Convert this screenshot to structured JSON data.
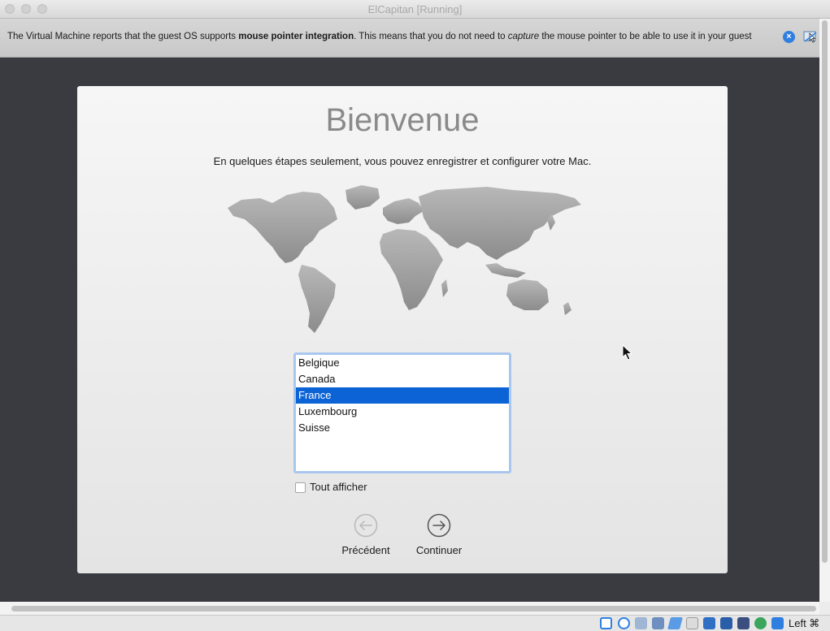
{
  "window": {
    "title": "ElCapitan [Running]"
  },
  "notice": {
    "text_1": "The Virtual Machine reports that the guest OS supports ",
    "text_bold": "mouse pointer integration",
    "text_2": ". This means that you do not need to ",
    "text_italic": "capture",
    "text_3": " the mouse pointer to be able to use it in your guest",
    "close_icon": "close-circle-icon",
    "mouse_icon": "mouse-integration-icon"
  },
  "setup": {
    "heading": "Bienvenue",
    "subtitle": "En quelques étapes seulement, vous pouvez enregistrer et configurer votre Mac.",
    "countries": [
      "Belgique",
      "Canada",
      "France",
      "Luxembourg",
      "Suisse"
    ],
    "selected_country": "France",
    "show_all_label": "Tout afficher",
    "show_all_checked": false,
    "back_label": "Précédent",
    "continue_label": "Continuer"
  },
  "statusbar": {
    "icons": [
      "hard-disk-icon",
      "optical-disk-icon",
      "audio-icon",
      "network-icon",
      "usb-icon",
      "shared-folder-icon",
      "display-icon",
      "video-capture-icon",
      "recording-icon",
      "virtualization-icon",
      "cpu-icon",
      "arrow-down-icon"
    ],
    "host_key": "Left ⌘"
  },
  "colors": {
    "selection": "#0b63d6",
    "vm_background": "#3a3b40",
    "accent": "#2f7fe0"
  }
}
